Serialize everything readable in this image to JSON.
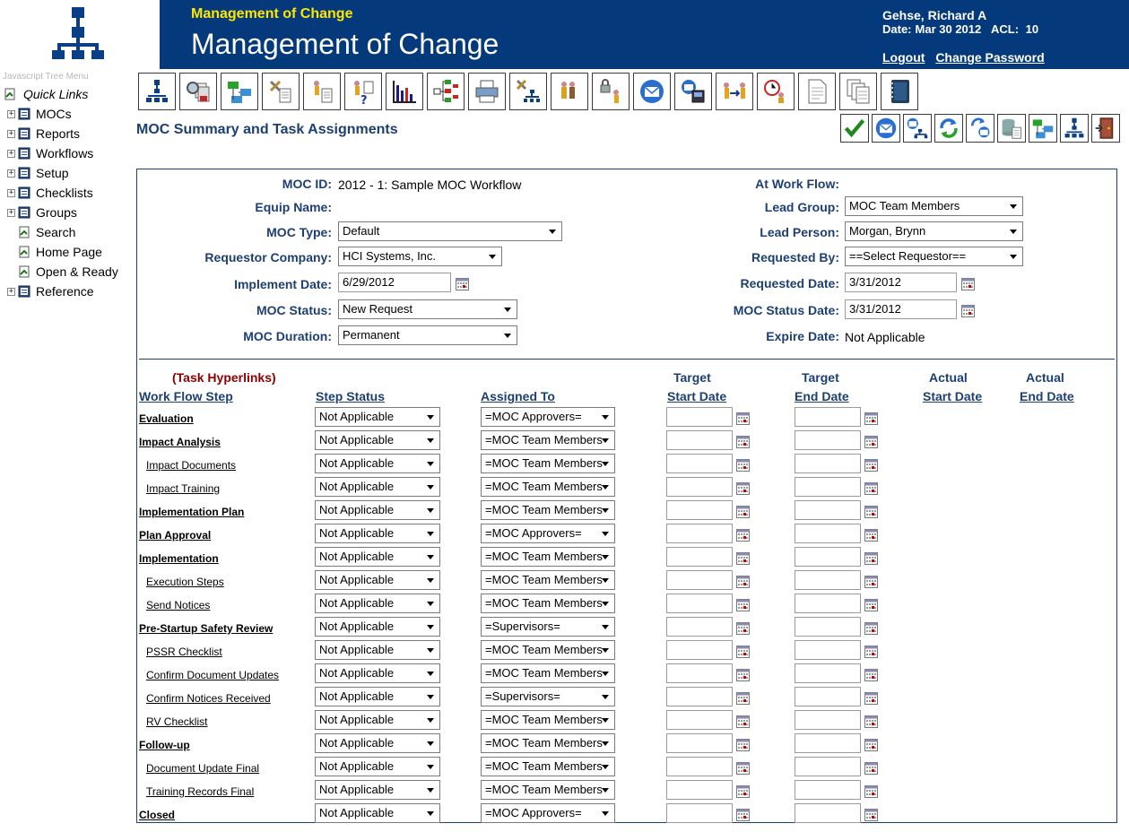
{
  "app": {
    "subtitle": "Management of Change",
    "title": "Management of Change",
    "user": "Gehse, Richard A",
    "date_label": "Date:",
    "date_value": "Mar 30 2012",
    "acl_label": "ACL:",
    "acl_value": "10",
    "logout": "Logout",
    "change_password": "Change Password",
    "header_color": "#043a7c",
    "subtitle_color": "#ffe600"
  },
  "tree": {
    "caption": "Javascript Tree Menu",
    "quick_links": "Quick Links",
    "items": [
      {
        "label": "MOCs",
        "expandable": true
      },
      {
        "label": "Reports",
        "expandable": true
      },
      {
        "label": "Workflows",
        "expandable": true
      },
      {
        "label": "Setup",
        "expandable": true
      },
      {
        "label": "Checklists",
        "expandable": true
      },
      {
        "label": "Groups",
        "expandable": true
      },
      {
        "label": "Search",
        "expandable": false
      },
      {
        "label": "Home Page",
        "expandable": false
      },
      {
        "label": "Open & Ready",
        "expandable": false
      },
      {
        "label": "Reference",
        "expandable": true
      }
    ]
  },
  "toolbar": {
    "icons": [
      "workflow-icon",
      "search-docs-icon",
      "groups-icon",
      "tools-doc-icon",
      "person-doc-icon",
      "person-question-icon",
      "bar-chart-icon",
      "org-tree-icon",
      "printer-icon",
      "tools-tree-icon",
      "people-icon",
      "lock-person-icon",
      "email-icon",
      "email-phone-icon",
      "person-transfer-icon",
      "alarm-people-icon",
      "document-icon",
      "documents-icon",
      "notebook-icon"
    ]
  },
  "page": {
    "title": "MOC Summary and Task Assignments"
  },
  "actions": {
    "icons": [
      "save-check-icon",
      "email-icon",
      "email-tree-icon",
      "refresh-icon",
      "refresh-email-icon",
      "database-doc-icon",
      "groups-icon",
      "workflow-icon",
      "exit-door-icon"
    ]
  },
  "form": {
    "moc_id": {
      "label": "MOC ID:",
      "value": "2012 - 1: Sample MOC Workflow"
    },
    "equip_name": {
      "label": "Equip Name:"
    },
    "moc_type": {
      "label": "MOC Type:",
      "value": "Default"
    },
    "requestor_company": {
      "label": "Requestor Company:",
      "value": "HCI Systems, Inc."
    },
    "implement_date": {
      "label": "Implement Date:",
      "value": "6/29/2012"
    },
    "moc_status": {
      "label": "MOC Status:",
      "value": "New Request"
    },
    "moc_duration": {
      "label": "MOC Duration:",
      "value": "Permanent"
    },
    "at_work_flow": {
      "label": "At Work Flow:"
    },
    "lead_group": {
      "label": "Lead Group:",
      "value": "MOC Team Members"
    },
    "lead_person": {
      "label": "Lead Person:",
      "value": "Morgan, Brynn"
    },
    "requested_by": {
      "label": "Requested By:",
      "value": "==Select Requestor=="
    },
    "requested_date": {
      "label": "Requested Date:",
      "value": "3/31/2012"
    },
    "moc_status_date": {
      "label": "MOC Status Date:",
      "value": "3/31/2012"
    },
    "expire_date": {
      "label": "Expire Date:",
      "value": "Not Applicable"
    }
  },
  "tasks": {
    "hyperlinks_label": "(Task Hyperlinks)",
    "headers": {
      "step": "Work Flow Step",
      "status": "Step Status",
      "assigned": "Assigned To",
      "target_top": "Target",
      "target_start": "Start Date",
      "target_top2": "Target",
      "target_end": "End Date",
      "actual_top": "Actual",
      "actual_start": "Start Date",
      "actual_top2": "Actual",
      "actual_end": "End Date"
    },
    "rows": [
      {
        "step": "Evaluation",
        "bold": true,
        "status": "Not Applicable",
        "assigned": "=MOC Approvers="
      },
      {
        "step": "Impact Analysis",
        "bold": true,
        "status": "Not Applicable",
        "assigned": "=MOC Team Members"
      },
      {
        "step": "Impact Documents",
        "bold": false,
        "status": "Not Applicable",
        "assigned": "=MOC Team Members"
      },
      {
        "step": "Impact Training",
        "bold": false,
        "status": "Not Applicable",
        "assigned": "=MOC Team Members"
      },
      {
        "step": "Implementation Plan",
        "bold": true,
        "status": "Not Applicable",
        "assigned": "=MOC Team Members"
      },
      {
        "step": "Plan Approval",
        "bold": true,
        "status": "Not Applicable",
        "assigned": "=MOC Approvers="
      },
      {
        "step": "Implementation",
        "bold": true,
        "status": "Not Applicable",
        "assigned": "=MOC Team Members"
      },
      {
        "step": "Execution Steps",
        "bold": false,
        "status": "Not Applicable",
        "assigned": "=MOC Team Members"
      },
      {
        "step": "Send Notices",
        "bold": false,
        "status": "Not Applicable",
        "assigned": "=MOC Team Members"
      },
      {
        "step": "Pre-Startup Safety Review",
        "bold": true,
        "status": "Not Applicable",
        "assigned": "=Supervisors="
      },
      {
        "step": "PSSR Checklist",
        "bold": false,
        "status": "Not Applicable",
        "assigned": "=MOC Team Members"
      },
      {
        "step": "Confirm Document Updates",
        "bold": false,
        "status": "Not Applicable",
        "assigned": "=MOC Team Members"
      },
      {
        "step": "Confirm Notices Received",
        "bold": false,
        "status": "Not Applicable",
        "assigned": "=Supervisors="
      },
      {
        "step": "RV Checklist",
        "bold": false,
        "status": "Not Applicable",
        "assigned": "=MOC Team Members"
      },
      {
        "step": "Follow-up",
        "bold": true,
        "status": "Not Applicable",
        "assigned": "=MOC Team Members"
      },
      {
        "step": "Document Update Final",
        "bold": false,
        "status": "Not Applicable",
        "assigned": "=MOC Team Members"
      },
      {
        "step": "Training Records Final",
        "bold": false,
        "status": "Not Applicable",
        "assigned": "=MOC Team Members"
      },
      {
        "step": "Closed",
        "bold": true,
        "status": "Not Applicable",
        "assigned": "=MOC Approvers="
      }
    ]
  },
  "colors": {
    "label_blue": "#1d3f73",
    "hyperlink_red": "#8b0000"
  }
}
